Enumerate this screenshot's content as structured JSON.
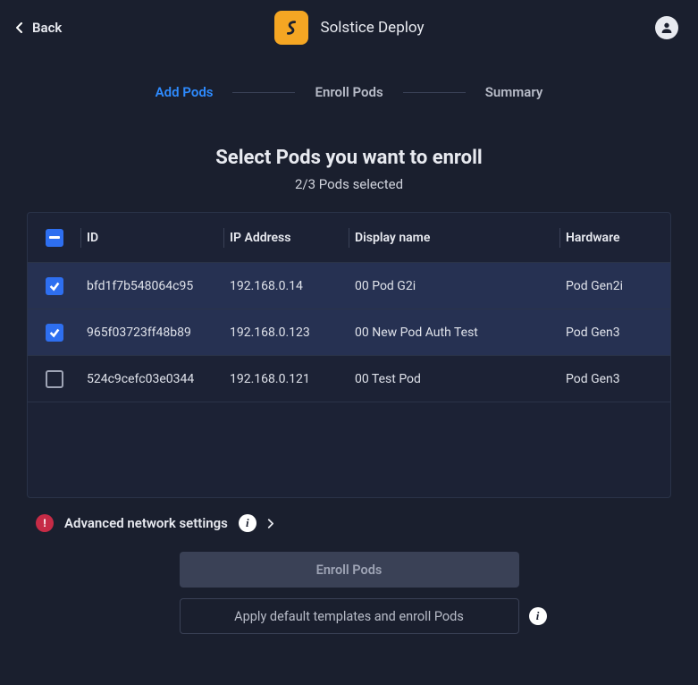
{
  "header": {
    "back_label": "Back",
    "brand": "Solstice Deploy"
  },
  "stepper": {
    "steps": [
      "Add Pods",
      "Enroll Pods",
      "Summary"
    ],
    "active_index": 0
  },
  "title_block": {
    "title": "Select Pods you want to enroll",
    "subtitle": "2/3 Pods selected"
  },
  "table": {
    "columns": [
      "ID",
      "IP Address",
      "Display name",
      "Hardware"
    ],
    "select_all_state": "indeterminate",
    "rows": [
      {
        "selected": true,
        "id": "bfd1f7b548064c95",
        "ip": "192.168.0.14",
        "display": "00 Pod G2i",
        "hardware": "Pod Gen2i"
      },
      {
        "selected": true,
        "id": "965f03723ff48b89",
        "ip": "192.168.0.123",
        "display": "00 New Pod Auth Test",
        "hardware": "Pod Gen3"
      },
      {
        "selected": false,
        "id": "524c9cefc03e0344",
        "ip": "192.168.0.121",
        "display": "00 Test Pod",
        "hardware": "Pod Gen3"
      }
    ]
  },
  "advanced": {
    "label": "Advanced network settings"
  },
  "actions": {
    "primary_label": "Enroll Pods",
    "secondary_label": "Apply default templates and enroll Pods"
  }
}
